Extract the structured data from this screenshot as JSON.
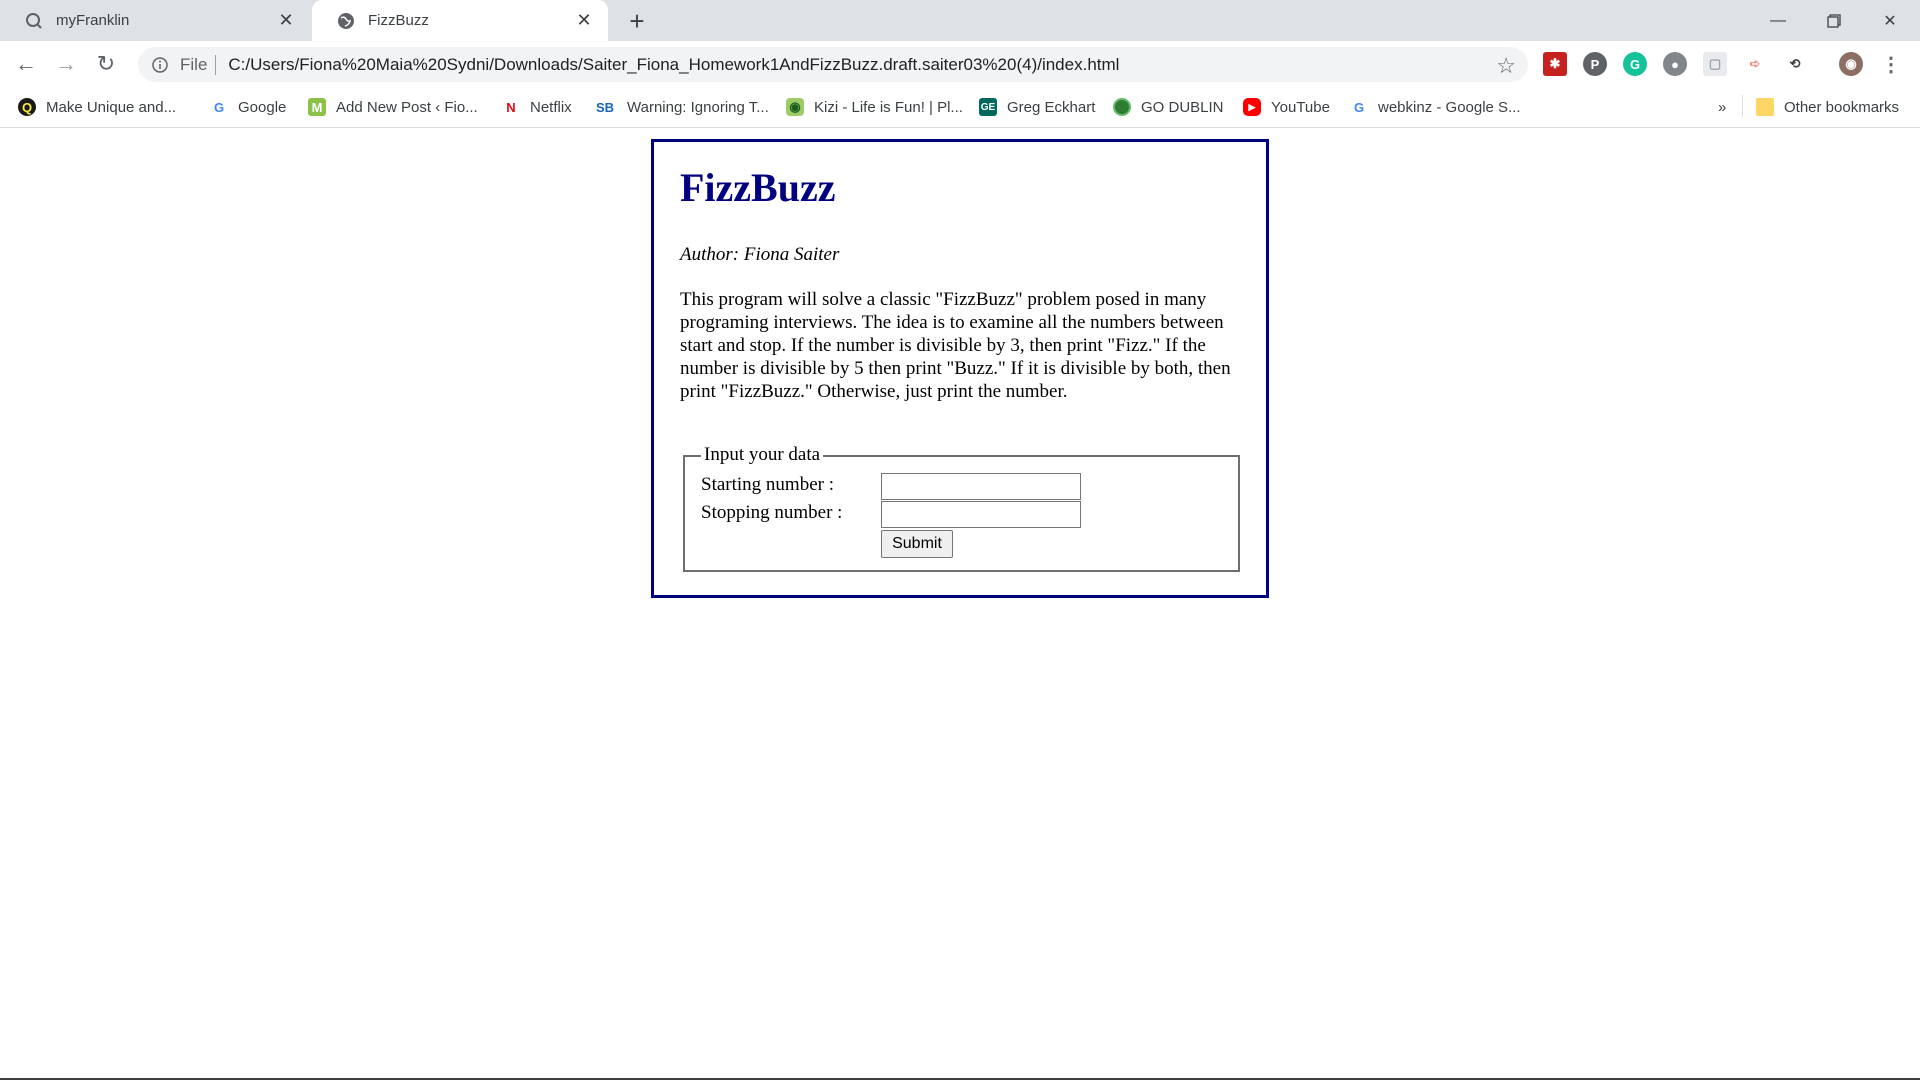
{
  "browser": {
    "tabs": [
      {
        "title": "myFranklin",
        "active": false
      },
      {
        "title": "FizzBuzz",
        "active": true
      }
    ],
    "address": {
      "scheme_label": "File",
      "url": "C:/Users/Fiona%20Maia%20Sydni/Downloads/Saiter_Fiona_Homework1AndFizzBuzz.draft.saiter03%20(4)/index.html"
    },
    "bookmarks": [
      {
        "label": "Make Unique and...",
        "icon": "quizlet-icon"
      },
      {
        "label": "Google",
        "icon": "google-icon"
      },
      {
        "label": "Add New Post ‹ Fio...",
        "icon": "m-icon"
      },
      {
        "label": "Netflix",
        "icon": "netflix-icon"
      },
      {
        "label": "Warning: Ignoring T...",
        "icon": "sb-icon"
      },
      {
        "label": "Kizi - Life is Fun! | Pl...",
        "icon": "kizi-icon"
      },
      {
        "label": "Greg Eckhart",
        "icon": "ge-icon"
      },
      {
        "label": "GO DUBLIN",
        "icon": "green-circle-icon"
      },
      {
        "label": "YouTube",
        "icon": "youtube-icon"
      },
      {
        "label": "webkinz - Google S...",
        "icon": "google-icon"
      }
    ],
    "overflow_label": "»",
    "other_bookmarks": "Other bookmarks"
  },
  "page": {
    "heading": "FizzBuzz",
    "author": "Author: Fiona Saiter",
    "description": "This program will solve a classic \"FizzBuzz\" problem posed in many programing interviews. The idea is to examine all the numbers between start and stop. If the number is divisible by 3, then print \"Fizz.\" If the number is divisible by 5 then print \"Buzz.\" If it is divisible by both, then print \"FizzBuzz.\" Otherwise, just print the number.",
    "form": {
      "legend": "Input your data",
      "start_label": "Starting number :",
      "start_value": "",
      "stop_label": "Stopping number :",
      "stop_value": "",
      "submit_label": "Submit"
    }
  },
  "colors": {
    "heading": "#000080",
    "card_border": "#000080",
    "tabstrip": "#dee1e6"
  }
}
